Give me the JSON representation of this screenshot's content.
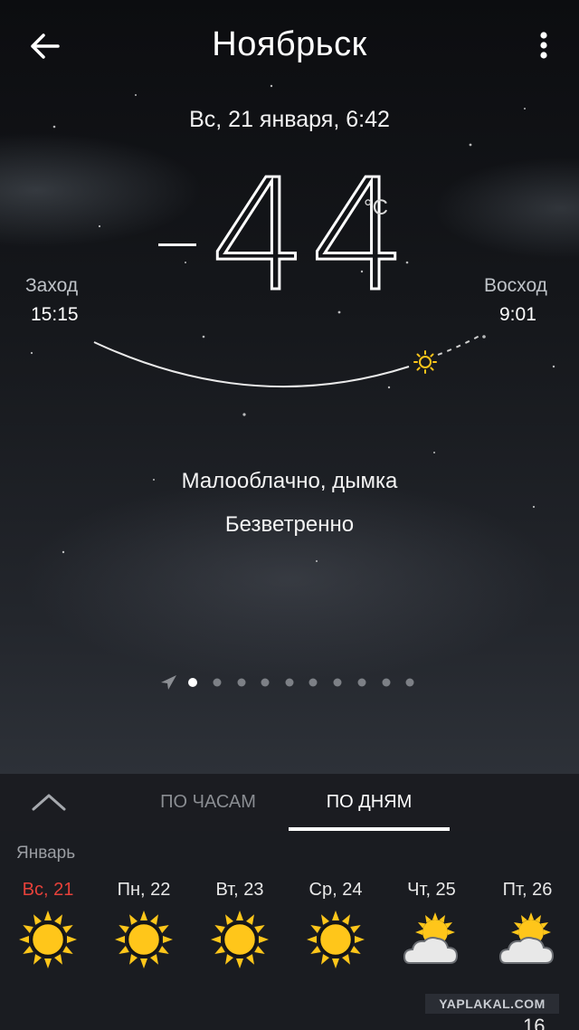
{
  "header": {
    "city": "Ноябрьск",
    "back_icon": "arrow-left-icon",
    "menu_icon": "more-vertical-icon"
  },
  "current": {
    "datetime": "Вс, 21 января, 6:42",
    "temperature": "44",
    "unit": "°C",
    "sunset_label": "Заход",
    "sunset_time": "15:15",
    "sunrise_label": "Восход",
    "sunrise_time": "9:01",
    "condition": "Малооблачно, дымка",
    "wind": "Безветренно"
  },
  "pager": {
    "location_icon": "location-arrow-icon",
    "count": 10,
    "active_index": 0
  },
  "tabs": {
    "hourly": "ПО ЧАСАМ",
    "daily": "ПО ДНЯМ",
    "active": "daily",
    "collapse_icon": "chevron-up-icon"
  },
  "forecast": {
    "month": "Январь",
    "days": [
      {
        "label": "Вс, 21",
        "icon": "sun-icon",
        "today": true
      },
      {
        "label": "Пн, 22",
        "icon": "sun-icon"
      },
      {
        "label": "Вт, 23",
        "icon": "sun-icon"
      },
      {
        "label": "Ср, 24",
        "icon": "sun-icon"
      },
      {
        "label": "Чт, 25",
        "icon": "partly-cloudy-icon"
      },
      {
        "label": "Пт, 26",
        "icon": "partly-cloudy-icon"
      }
    ],
    "next_partial": "16"
  },
  "watermark": "YAPLAKAL.COM",
  "colors": {
    "today": "#e6413a",
    "sun": "#ffc61a",
    "cloud": "#e8e8e8"
  }
}
